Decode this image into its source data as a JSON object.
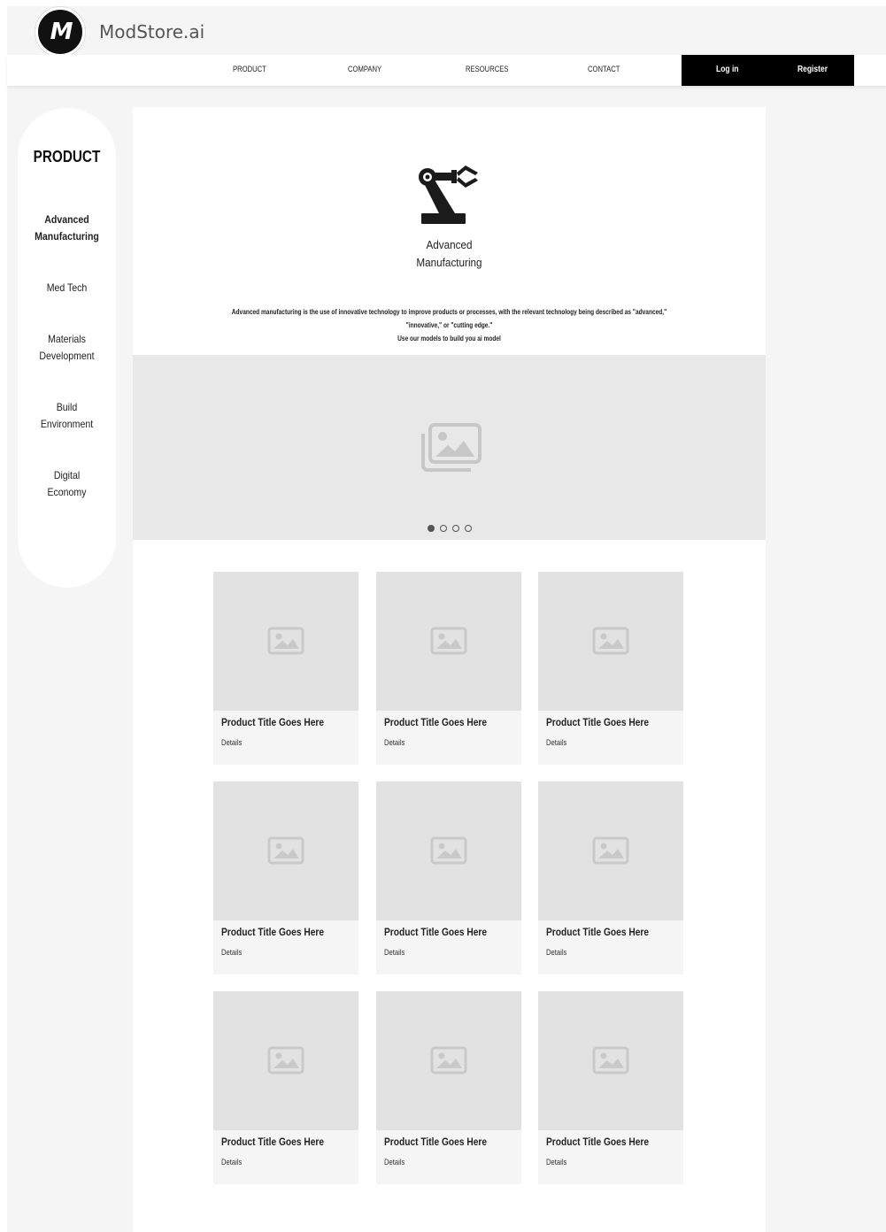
{
  "header": {
    "logo_text": "M",
    "brand": "ModStore.ai",
    "nav": [
      "PRODUCT",
      "COMPANY",
      "RESOURCES",
      "CONTACT"
    ],
    "login": "Log in",
    "register": "Register"
  },
  "sidebar": {
    "title": "PRODUCT",
    "items": [
      {
        "line1": "Advanced",
        "line2": "Manufacturing"
      },
      {
        "line1": "Med Tech",
        "line2": ""
      },
      {
        "line1": "Materials",
        "line2": "Development"
      },
      {
        "line1": "Build",
        "line2": "Environment"
      },
      {
        "line1": "Digital",
        "line2": "Economy"
      }
    ]
  },
  "hero": {
    "icon": "robot-arm-icon",
    "title_line1": "Advanced",
    "title_line2": "Manufacturing",
    "desc_line1": "Advanced manufacturing is the use of innovative technology to improve products or processes, with the relevant technology being described as \"advanced,\"",
    "desc_line2": "\"innovative,\" or \"cutting edge.\"",
    "desc_line3": "Use our models to build you ai model"
  },
  "slider": {
    "icon": "image-gallery-icon",
    "slide_count": 4,
    "active_slide": 1
  },
  "products": [
    {
      "title": "Product Title Goes Here",
      "details": "Details"
    },
    {
      "title": "Product Title Goes Here",
      "details": "Details"
    },
    {
      "title": "Product Title Goes Here",
      "details": "Details"
    },
    {
      "title": "Product Title Goes Here",
      "details": "Details"
    },
    {
      "title": "Product Title Goes Here",
      "details": "Details"
    },
    {
      "title": "Product Title Goes Here",
      "details": "Details"
    },
    {
      "title": "Product Title Goes Here",
      "details": "Details"
    },
    {
      "title": "Product Title Goes Here",
      "details": "Details"
    },
    {
      "title": "Product Title Goes Here",
      "details": "Details"
    }
  ]
}
